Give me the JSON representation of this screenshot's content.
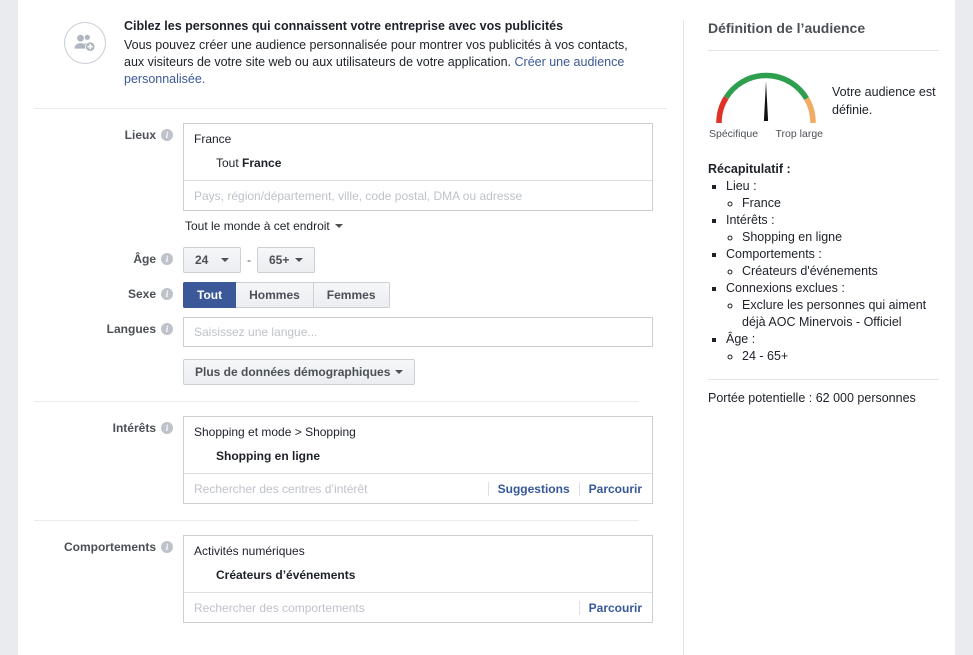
{
  "banner": {
    "icon": "add-people-icon",
    "title": "Ciblez les personnes qui connaissent votre entreprise avec vos publicités",
    "body_part1": "Vous pouvez créer une audience personnalisée pour montrer vos publicités à vos contacts, aux visiteurs de votre site web ou aux utilisateurs de votre application.",
    "link_text": "Créer une audience personnalisée."
  },
  "form": {
    "locations": {
      "label": "Lieux",
      "info_icon": "info-icon",
      "token_parent": "France",
      "token_child_prefix": "Tout ",
      "token_child": "France",
      "input_placeholder": "Pays, région/département, ville, code postal, DMA ou adresse",
      "scope_label": "Tout le monde à cet endroit"
    },
    "age": {
      "label": "Âge",
      "min": "24",
      "separator": "-",
      "max": "65+"
    },
    "gender": {
      "label": "Sexe",
      "options": [
        "Tout",
        "Hommes",
        "Femmes"
      ],
      "selected": "Tout"
    },
    "languages": {
      "label": "Langues",
      "value": "",
      "placeholder": "Saisissez une langue..."
    },
    "more_demographics": {
      "label": "Plus de données démographiques"
    },
    "interests": {
      "label": "Intérêts",
      "token_parent": "Shopping et mode > Shopping",
      "token_child": "Shopping en ligne",
      "input_placeholder": "Rechercher des centres d’intérêt",
      "actions": [
        "Suggestions",
        "Parcourir"
      ]
    },
    "behaviours": {
      "label": "Comportements",
      "token_parent": "Activités numériques",
      "token_child": "Créateurs d’événements",
      "input_placeholder": "Rechercher des comportements",
      "actions": [
        "Parcourir"
      ]
    }
  },
  "audience_panel": {
    "title": "Définition de l’audience",
    "gauge": {
      "left_label": "Spécifique",
      "right_label": "Trop large",
      "needle_angle_deg": 0,
      "colors": {
        "specific": "#e0302a",
        "defined": "#2e9e4f",
        "broad": "#f2ab62"
      }
    },
    "caption": "Votre audience est définie.",
    "recap_title": "Récapitulatif :",
    "recap": [
      {
        "label": "Lieu :",
        "values": [
          "France"
        ]
      },
      {
        "label": "Intérêts :",
        "values": [
          "Shopping en ligne"
        ]
      },
      {
        "label": "Comportements :",
        "values": [
          "Créateurs d'événements"
        ]
      },
      {
        "label": "Connexions exclues :",
        "values": [
          "Exclure les personnes qui aiment déjà AOC Minervois - Officiel"
        ]
      },
      {
        "label": "Âge :",
        "values": [
          "24 - 65+"
        ]
      }
    ],
    "reach": "Portée potentielle : 62 000 personnes"
  }
}
